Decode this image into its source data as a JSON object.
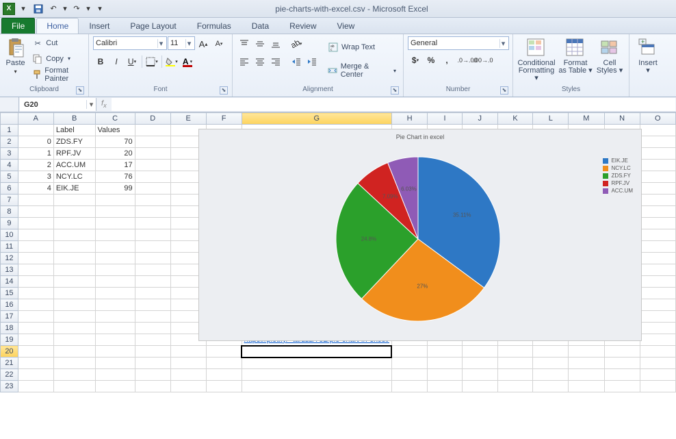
{
  "title": "pie-charts-with-excel.csv - Microsoft Excel",
  "tabs": {
    "file": "File",
    "home": "Home",
    "insert": "Insert",
    "pagelayout": "Page Layout",
    "formulas": "Formulas",
    "data": "Data",
    "review": "Review",
    "view": "View"
  },
  "ribbon": {
    "clipboard": {
      "paste": "Paste",
      "cut": "Cut",
      "copy": "Copy",
      "painter": "Format Painter",
      "label": "Clipboard"
    },
    "font": {
      "name": "Calibri",
      "size": "11",
      "label": "Font"
    },
    "alignment": {
      "wrap": "Wrap Text",
      "merge": "Merge & Center",
      "label": "Alignment"
    },
    "number": {
      "format": "General",
      "label": "Number"
    },
    "styles": {
      "cond": "Conditional",
      "cond2": "Formatting",
      "fmt": "Format",
      "fmt2": "as Table",
      "cell": "Cell",
      "cell2": "Styles",
      "label": "Styles"
    },
    "cells": {
      "insert": "Insert",
      "label": ""
    }
  },
  "namebox": "G20",
  "sheetdata": {
    "headerRow": [
      "",
      "Label",
      "Values"
    ],
    "rows": [
      [
        "0",
        "ZDS.FY",
        "70"
      ],
      [
        "1",
        "RPF.JV",
        "20"
      ],
      [
        "2",
        "ACC.UM",
        "17"
      ],
      [
        "3",
        "NCY.LC",
        "76"
      ],
      [
        "4",
        "EIK.JE",
        "99"
      ]
    ],
    "link": "https://plot.ly/~tarzzz/782/pie-chart-in-excel/"
  },
  "chart_data": {
    "type": "pie",
    "title": "Pie Chart in excel",
    "categories": [
      "EIK.JE",
      "NCY.LC",
      "ZDS.FY",
      "RPF.JV",
      "ACC.UM"
    ],
    "values": [
      99,
      76,
      70,
      20,
      17
    ],
    "percentages": [
      35.11,
      26.95,
      24.82,
      7.09,
      6.03
    ],
    "colors": [
      "#2e78c5",
      "#f18e1c",
      "#2ba02b",
      "#d02321",
      "#8f5bb6"
    ],
    "slice_labels": [
      "35.11%",
      "27%",
      "24.8%",
      "7.09%",
      "6.03%"
    ],
    "legend_position": "right"
  },
  "columns": [
    "A",
    "B",
    "C",
    "D",
    "E",
    "F",
    "G",
    "H",
    "I",
    "J",
    "K",
    "L",
    "M",
    "N",
    "O"
  ],
  "rowcount": 23,
  "selected": {
    "col": "G",
    "row": 20
  }
}
